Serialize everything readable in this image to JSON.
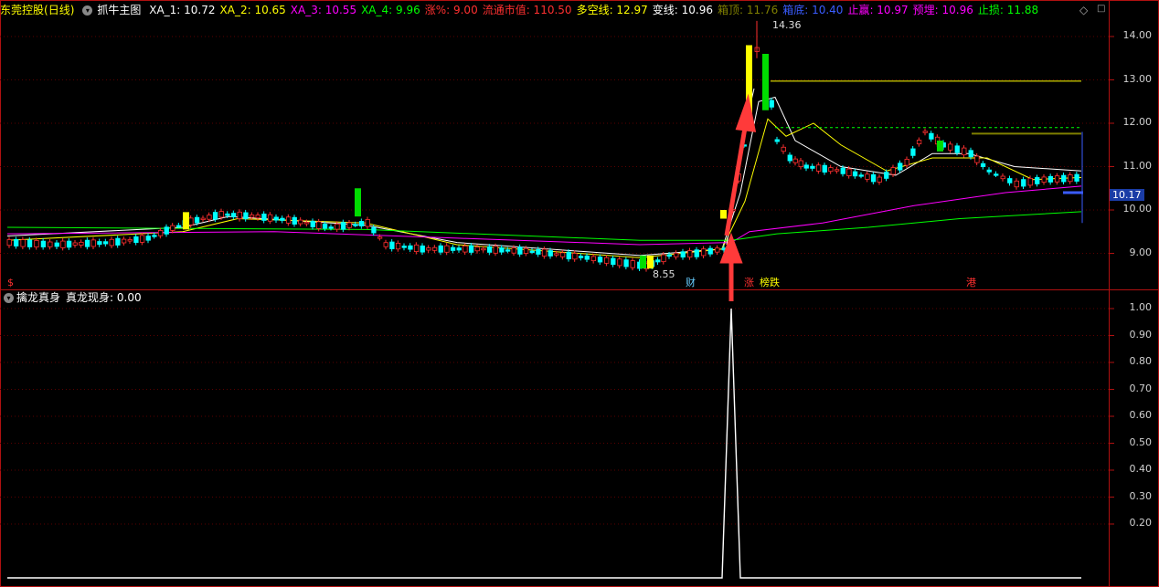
{
  "header": {
    "stock_name": "东莞控股",
    "period": "(日线)",
    "indicator": "抓牛主图",
    "items": [
      {
        "label": "XA_1: 10.72",
        "color": "#ffffff"
      },
      {
        "label": "XA_2: 10.65",
        "color": "#ffff00"
      },
      {
        "label": "XA_3: 10.55",
        "color": "#ff00ff"
      },
      {
        "label": "XA_4: 9.96",
        "color": "#00ff00"
      },
      {
        "label": "涨%: 9.00",
        "color": "#ff3030"
      },
      {
        "label": "流通市值: 110.50",
        "color": "#ff3030"
      },
      {
        "label": "多空线: 12.97",
        "color": "#ffff00"
      },
      {
        "label": "变线: 10.96",
        "color": "#ffffff"
      },
      {
        "label": "箱顶: 11.76",
        "color": "#808000"
      },
      {
        "label": "箱底: 10.40",
        "color": "#3a5cff"
      },
      {
        "label": "止赢: 10.97",
        "color": "#ff00ff"
      },
      {
        "label": "预埋: 10.96",
        "color": "#ff00ff"
      },
      {
        "label": "止损: 11.88",
        "color": "#00ff00"
      }
    ]
  },
  "sub_header": {
    "indicator": "擒龙真身",
    "value": "真龙现身: 0.00"
  },
  "main_axis": {
    "ticks": [
      "14.00",
      "13.00",
      "12.00",
      "11.00",
      "10.00",
      "9.00"
    ],
    "current_price": "10.17"
  },
  "sub_axis": {
    "ticks": [
      "1.00",
      "0.90",
      "0.80",
      "0.70",
      "0.60",
      "0.50",
      "0.40",
      "0.30",
      "0.20"
    ]
  },
  "annotations": {
    "high": "14.36",
    "low": "8.55",
    "marker_cai": "财",
    "marker_zhang": "涨",
    "marker_bangdie": "榜跌",
    "marker_gang": "港",
    "marker_left": "$"
  },
  "colors": {
    "up": "#ff3030",
    "down": "#00ffff",
    "border": "#b01010"
  }
}
